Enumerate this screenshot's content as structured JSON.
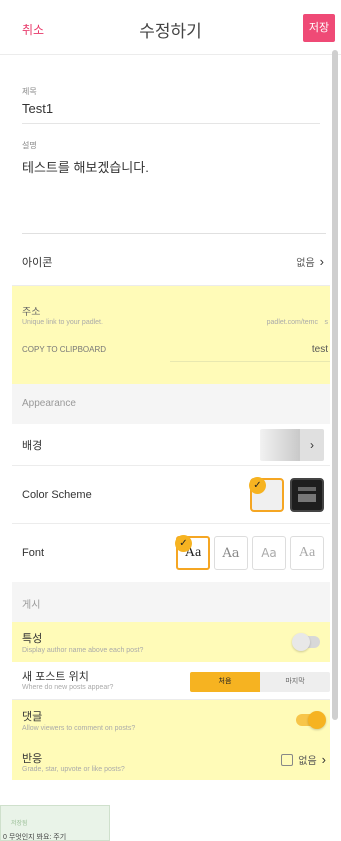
{
  "header": {
    "cancel": "취소",
    "title": "수정하기",
    "save": "저장"
  },
  "title_field": {
    "label": "제목",
    "value": "Test1"
  },
  "description": {
    "label": "설명",
    "value": "테스트를 해보겠습니다."
  },
  "icon": {
    "label": "아이콘",
    "value": "없음"
  },
  "address": {
    "label": "주소",
    "hint": "Unique link to your padlet.",
    "url_prefix": "padlet.com/temc",
    "url_suffix": "s",
    "copy": "COPY TO CLIPBOARD",
    "value": "test"
  },
  "appearance": {
    "heading": "Appearance",
    "background_label": "배경",
    "color_scheme_label": "Color Scheme",
    "color_scheme_selected": "light",
    "font_label": "Font",
    "font_options": [
      "Aa",
      "Aa",
      "Aa",
      "Aa"
    ],
    "font_selected_index": 0
  },
  "posting": {
    "heading": "게시",
    "attribution": {
      "label": "특성",
      "hint": "Display author name above each post?",
      "enabled": false
    },
    "new_post_position": {
      "label": "새 포스트 위치",
      "hint": "Where do new posts appear?",
      "options": [
        "처음",
        "마지막"
      ],
      "selected": "처음"
    },
    "comments": {
      "label": "댓글",
      "hint": "Allow viewers to comment on posts?",
      "enabled": true
    },
    "reactions": {
      "label": "반응",
      "hint": "Grade, star, upvote or like posts?",
      "value": "없음"
    }
  },
  "toast": {
    "line1": "저장됨",
    "line2": "0 무엇인지 봐요: 주기"
  },
  "colors": {
    "accent_pink": "#ef4a76",
    "highlight_yellow": "#fffbb8",
    "toggle_on": "#f6b321"
  }
}
